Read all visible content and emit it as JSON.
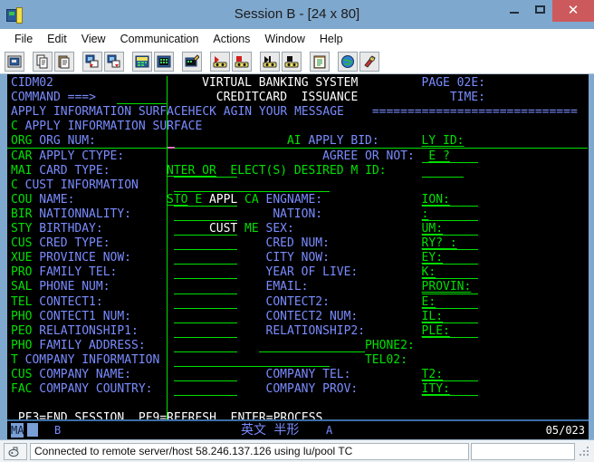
{
  "window": {
    "title": "Session B - [24 x 80]",
    "icon": "terminal-session-icon",
    "minimize_label": "–",
    "maximize_label": "❑",
    "close_label": "✕"
  },
  "menubar": {
    "items": [
      {
        "label": "File"
      },
      {
        "label": "Edit"
      },
      {
        "label": "View"
      },
      {
        "label": "Communication"
      },
      {
        "label": "Actions"
      },
      {
        "label": "Window"
      },
      {
        "label": "Help"
      }
    ]
  },
  "toolbar": {
    "buttons": [
      {
        "name": "new-session-icon",
        "tip": "New Session"
      },
      {
        "name": "copy-icon",
        "tip": "Copy"
      },
      {
        "name": "paste-icon",
        "tip": "Paste"
      },
      {
        "name": "send-file-icon",
        "tip": "Send File to Host"
      },
      {
        "name": "receive-file-icon",
        "tip": "Receive File from Host"
      },
      {
        "name": "keypad-icon",
        "tip": "Keypad"
      },
      {
        "name": "keyboard-setup-icon",
        "tip": "Keyboard Setup"
      },
      {
        "name": "edit-keyboard-icon",
        "tip": "Edit Keyboard"
      },
      {
        "name": "record-macro-icon",
        "tip": "Record Macro"
      },
      {
        "name": "stop-record-icon",
        "tip": "Stop Recording"
      },
      {
        "name": "play-macro-icon",
        "tip": "Play Macro"
      },
      {
        "name": "stop-macro-icon",
        "tip": "Stop Macro"
      },
      {
        "name": "clipboard-icon",
        "tip": "Clipboard"
      },
      {
        "name": "globe-icon",
        "tip": "Internet Service"
      },
      {
        "name": "help-index-icon",
        "tip": "Help Index"
      }
    ]
  },
  "terminal": {
    "size": "24 x 80",
    "colors": {
      "background": "#000000",
      "green": "#00e000",
      "blue": "#7a8cff",
      "white": "#ffffff",
      "cursor": "#e070c0"
    },
    "lines": [
      {
        "row": 1,
        "segments": [
          {
            "text": "CIDM02",
            "color": "blue",
            "col": 1
          },
          {
            "text": "VIRTUAL BANKING SYSTEM",
            "color": "white",
            "col": 28
          },
          {
            "text": "PAGE 02E:",
            "color": "blue",
            "col": 59
          }
        ]
      },
      {
        "row": 2,
        "segments": [
          {
            "text": "COMMAND ===>",
            "color": "blue",
            "col": 1
          },
          {
            "text": "CREDITCARD  ISSUANCE",
            "color": "white",
            "col": 30
          },
          {
            "text": "TIME:",
            "color": "blue",
            "col": 63
          }
        ]
      },
      {
        "row": 3,
        "segments": [
          {
            "text": "APPLY INFORMATION SURFACEHECK AGIN YOUR MESSAGE",
            "color": "blue",
            "col": 1
          },
          {
            "text": "=============================",
            "color": "blue",
            "col": 52
          }
        ]
      },
      {
        "row": 4,
        "segments": [
          {
            "text": "C",
            "color": "green",
            "col": 1
          },
          {
            "text": "APPLY INFORMATION SURFACE",
            "color": "blue",
            "col": 3
          }
        ]
      },
      {
        "row": 5,
        "segments": [
          {
            "text": "ORG",
            "color": "green",
            "col": 1
          },
          {
            "text": "ORG NUM:",
            "color": "blue",
            "col": 5
          },
          {
            "text": "AI",
            "color": "green",
            "col": 40
          },
          {
            "text": "APPLY BID:",
            "color": "blue",
            "col": 43
          },
          {
            "text": "LY ID:",
            "color": "green",
            "col": 59,
            "underline": true
          }
        ]
      },
      {
        "row": 6,
        "segments": [
          {
            "text": "CAR",
            "color": "green",
            "col": 1
          },
          {
            "text": "APPLY CTYPE:",
            "color": "blue",
            "col": 5
          },
          {
            "text": "AGREE OR NOT:",
            "color": "blue",
            "col": 45
          },
          {
            "text": "E ?",
            "color": "green",
            "col": 60,
            "underline": true
          }
        ]
      },
      {
        "row": 7,
        "segments": [
          {
            "text": "MAI",
            "color": "green",
            "col": 1
          },
          {
            "text": "CARD TYPE:",
            "color": "blue",
            "col": 5
          },
          {
            "text": "NTER OR",
            "color": "green",
            "col": 23,
            "underline": true
          },
          {
            "text": "ELECT(S) DESIRED M ID:",
            "color": "green",
            "col": 32
          }
        ]
      },
      {
        "row": 8,
        "segments": [
          {
            "text": "C",
            "color": "green",
            "col": 1
          },
          {
            "text": "CUST INFORMATION",
            "color": "blue",
            "col": 3
          }
        ]
      },
      {
        "row": 9,
        "segments": [
          {
            "text": "COU",
            "color": "green",
            "col": 1
          },
          {
            "text": "NAME:",
            "color": "blue",
            "col": 5
          },
          {
            "text": "STO",
            "color": "green",
            "col": 23,
            "underline": true
          },
          {
            "text": "E",
            "color": "green",
            "col": 27
          },
          {
            "text": "APPL",
            "color": "white",
            "col": 29
          },
          {
            "text": "CA",
            "color": "green",
            "col": 34
          },
          {
            "text": "ENGNAME:",
            "color": "blue",
            "col": 37
          },
          {
            "text": "ION:",
            "color": "green",
            "col": 59,
            "underline": true
          }
        ]
      },
      {
        "row": 10,
        "segments": [
          {
            "text": "BIR",
            "color": "green",
            "col": 1
          },
          {
            "text": "NATIONNALITY:",
            "color": "blue",
            "col": 5
          },
          {
            "text": "NATION:",
            "color": "blue",
            "col": 38
          },
          {
            "text": ":",
            "color": "green",
            "col": 59,
            "underline": true
          }
        ]
      },
      {
        "row": 11,
        "segments": [
          {
            "text": "STY",
            "color": "green",
            "col": 1
          },
          {
            "text": "BIRTHDAY:",
            "color": "blue",
            "col": 5
          },
          {
            "text": "CUST",
            "color": "white",
            "col": 29
          },
          {
            "text": "ME",
            "color": "green",
            "col": 34
          },
          {
            "text": "SEX:",
            "color": "blue",
            "col": 37
          },
          {
            "text": "UM:",
            "color": "green",
            "col": 59,
            "underline": true
          }
        ]
      },
      {
        "row": 12,
        "segments": [
          {
            "text": "CUS",
            "color": "green",
            "col": 1
          },
          {
            "text": "CRED TYPE:",
            "color": "blue",
            "col": 5
          },
          {
            "text": "CRED NUM:",
            "color": "blue",
            "col": 37
          },
          {
            "text": "RY? :",
            "color": "green",
            "col": 59,
            "underline": true
          }
        ]
      },
      {
        "row": 13,
        "segments": [
          {
            "text": "XUE",
            "color": "green",
            "col": 1
          },
          {
            "text": "PROVINCE NOW:",
            "color": "blue",
            "col": 5
          },
          {
            "text": "CITY NOW:",
            "color": "blue",
            "col": 37
          },
          {
            "text": "EY:",
            "color": "green",
            "col": 59,
            "underline": true
          }
        ]
      },
      {
        "row": 14,
        "segments": [
          {
            "text": "PRO",
            "color": "green",
            "col": 1
          },
          {
            "text": "FAMILY TEL:",
            "color": "blue",
            "col": 5
          },
          {
            "text": "YEAR OF LIVE:",
            "color": "blue",
            "col": 37
          },
          {
            "text": "K:",
            "color": "green",
            "col": 59,
            "underline": true
          }
        ]
      },
      {
        "row": 15,
        "segments": [
          {
            "text": "SAL",
            "color": "green",
            "col": 1
          },
          {
            "text": "PHONE NUM:",
            "color": "blue",
            "col": 5
          },
          {
            "text": "EMAIL:",
            "color": "blue",
            "col": 37
          },
          {
            "text": "PROVIN:",
            "color": "green",
            "col": 59,
            "underline": true
          }
        ]
      },
      {
        "row": 16,
        "segments": [
          {
            "text": "TEL",
            "color": "green",
            "col": 1
          },
          {
            "text": "CONTECT1:",
            "color": "blue",
            "col": 5
          },
          {
            "text": "CONTECT2:",
            "color": "blue",
            "col": 37
          },
          {
            "text": "E:",
            "color": "green",
            "col": 59,
            "underline": true
          }
        ]
      },
      {
        "row": 17,
        "segments": [
          {
            "text": "PHO",
            "color": "green",
            "col": 1
          },
          {
            "text": "CONTECT1 NUM:",
            "color": "blue",
            "col": 5
          },
          {
            "text": "CONTECT2 NUM:",
            "color": "blue",
            "col": 37
          },
          {
            "text": "IL:",
            "color": "green",
            "col": 59,
            "underline": true
          }
        ]
      },
      {
        "row": 18,
        "segments": [
          {
            "text": "PEO",
            "color": "green",
            "col": 1
          },
          {
            "text": "RELATIONSHIP1:",
            "color": "blue",
            "col": 5
          },
          {
            "text": "RELATIONSHIP2:",
            "color": "blue",
            "col": 37
          },
          {
            "text": "PLE:",
            "color": "green",
            "col": 59,
            "underline": true
          }
        ]
      },
      {
        "row": 19,
        "segments": [
          {
            "text": "PHO",
            "color": "green",
            "col": 1
          },
          {
            "text": "FAMILY ADDRESS:",
            "color": "blue",
            "col": 5
          },
          {
            "text": "PHONE2:",
            "color": "green",
            "col": 51
          }
        ]
      },
      {
        "row": 20,
        "segments": [
          {
            "text": "T",
            "color": "green",
            "col": 1
          },
          {
            "text": "COMPANY INFORMATION",
            "color": "blue",
            "col": 3
          },
          {
            "text": "TEL02:",
            "color": "green",
            "col": 51
          }
        ]
      },
      {
        "row": 21,
        "segments": [
          {
            "text": "CUS",
            "color": "green",
            "col": 1
          },
          {
            "text": "COMPANY NAME:",
            "color": "blue",
            "col": 5
          },
          {
            "text": "COMPANY TEL:",
            "color": "blue",
            "col": 37
          },
          {
            "text": "T2:",
            "color": "green",
            "col": 59,
            "underline": true
          }
        ]
      },
      {
        "row": 22,
        "segments": [
          {
            "text": "FAC",
            "color": "green",
            "col": 1
          },
          {
            "text": "COMPANY COUNTRY:",
            "color": "blue",
            "col": 5
          },
          {
            "text": "COMPANY PROV:",
            "color": "blue",
            "col": 37
          },
          {
            "text": "ITY:",
            "color": "green",
            "col": 59,
            "underline": true
          }
        ]
      },
      {
        "row": 23,
        "segments": []
      },
      {
        "row": 24,
        "segments": [
          {
            "text": "PF3=END SESSION  PF9=REFRESH  ENTER=PROCESS",
            "color": "white",
            "col": 2
          }
        ]
      }
    ]
  },
  "oia": {
    "connection_indicator": "MA",
    "session_letter": "B",
    "input_mode": "英文 半形",
    "keyboard_indicator": "A",
    "cursor_position": "05/023"
  },
  "statusbar": {
    "connection_icon": "connection-icon",
    "message": "Connected to remote server/host 58.246.137.126 using lu/pool TC",
    "resize_grip": "resize-grip-icon"
  }
}
